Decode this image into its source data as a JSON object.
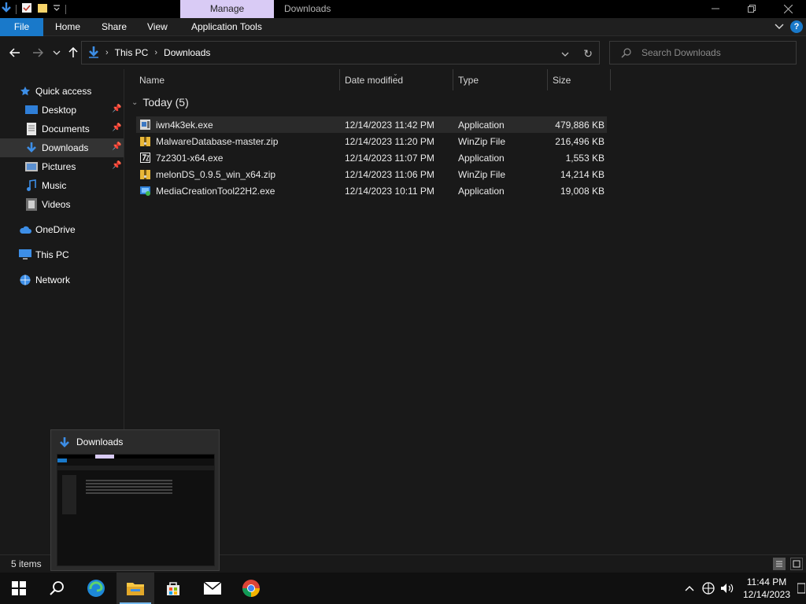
{
  "titlebar": {
    "manage_tab": "Manage",
    "window_title": "Downloads",
    "quick_access_icons": [
      "download-arrow-icon",
      "properties-icon",
      "new-folder-icon",
      "customize-qat-icon"
    ]
  },
  "ribbon": {
    "tabs": [
      "File",
      "Home",
      "Share",
      "View",
      "Application Tools"
    ],
    "help": "?"
  },
  "address": {
    "crumbs": [
      "This PC",
      "Downloads"
    ],
    "search_placeholder": "Search Downloads"
  },
  "nav": {
    "items": [
      {
        "label": "Quick access",
        "icon": "star-icon"
      },
      {
        "label": "Desktop",
        "icon": "desktop-icon",
        "pinned": true
      },
      {
        "label": "Documents",
        "icon": "documents-icon",
        "pinned": true
      },
      {
        "label": "Downloads",
        "icon": "downloads-icon",
        "pinned": true,
        "selected": true
      },
      {
        "label": "Pictures",
        "icon": "pictures-icon",
        "pinned": true
      },
      {
        "label": "Music",
        "icon": "music-icon"
      },
      {
        "label": "Videos",
        "icon": "videos-icon"
      },
      {
        "label": "OneDrive",
        "icon": "cloud-icon"
      },
      {
        "label": "This PC",
        "icon": "computer-icon"
      },
      {
        "label": "Network",
        "icon": "network-icon"
      }
    ]
  },
  "columns": {
    "name": "Name",
    "date": "Date modified",
    "type": "Type",
    "size": "Size"
  },
  "group": {
    "label": "Today (5)"
  },
  "files": [
    {
      "name": "iwn4k3ek.exe",
      "date": "12/14/2023 11:42 PM",
      "type": "Application",
      "size": "479,886 KB",
      "icon": "exe-icon"
    },
    {
      "name": "MalwareDatabase-master.zip",
      "date": "12/14/2023 11:20 PM",
      "type": "WinZip File",
      "size": "216,496 KB",
      "icon": "zip-icon"
    },
    {
      "name": "7z2301-x64.exe",
      "date": "12/14/2023 11:07 PM",
      "type": "Application",
      "size": "1,553 KB",
      "icon": "7zip-icon"
    },
    {
      "name": "melonDS_0.9.5_win_x64.zip",
      "date": "12/14/2023 11:06 PM",
      "type": "WinZip File",
      "size": "14,214 KB",
      "icon": "zip-icon"
    },
    {
      "name": "MediaCreationTool22H2.exe",
      "date": "12/14/2023 10:11 PM",
      "type": "Application",
      "size": "19,008 KB",
      "icon": "installer-icon"
    }
  ],
  "status": {
    "items": "5 items"
  },
  "thumbnail": {
    "title": "Downloads"
  },
  "taskbar": {
    "apps": [
      "windows-start-icon",
      "search-icon",
      "edge-icon",
      "file-explorer-icon",
      "store-icon",
      "mail-icon",
      "chrome-icon"
    ],
    "time": "11:44 PM",
    "date": "12/14/2023"
  },
  "colors": {
    "accent": "#1979ca",
    "manage_tab": "#d9cbf5",
    "selection": "#333333"
  }
}
